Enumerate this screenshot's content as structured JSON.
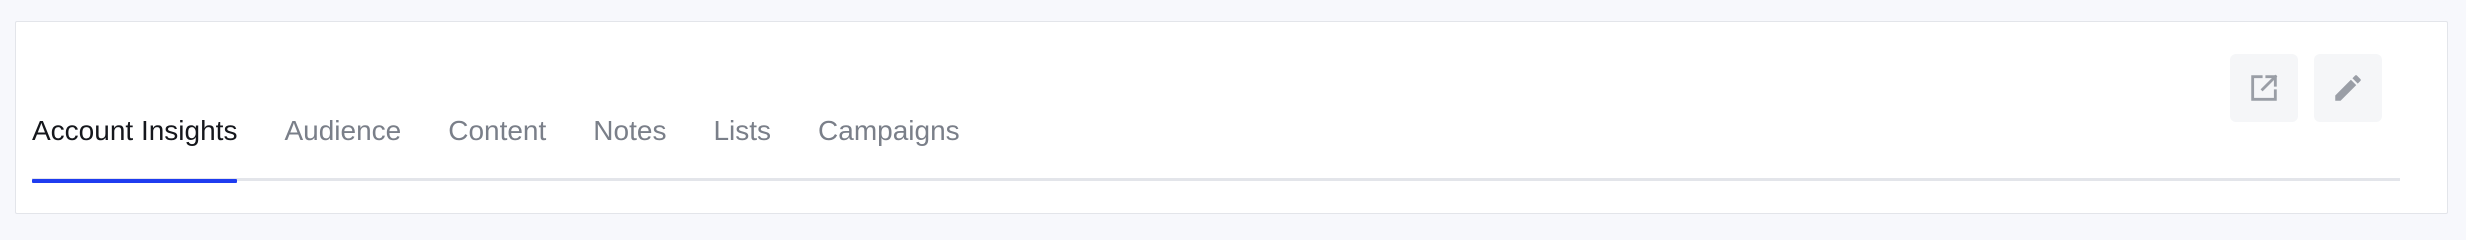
{
  "tabs": [
    {
      "label": "Account Insights",
      "active": true
    },
    {
      "label": "Audience",
      "active": false
    },
    {
      "label": "Content",
      "active": false
    },
    {
      "label": "Notes",
      "active": false
    },
    {
      "label": "Lists",
      "active": false
    },
    {
      "label": "Campaigns",
      "active": false
    }
  ],
  "actions": {
    "open_icon": "external-link-icon",
    "edit_icon": "pencil-icon"
  },
  "colors": {
    "active_tab_underline": "#1f3cf0",
    "active_tab_text": "#15171c",
    "inactive_tab_text": "#7a7f89",
    "icon_color": "#9a9ea6"
  }
}
